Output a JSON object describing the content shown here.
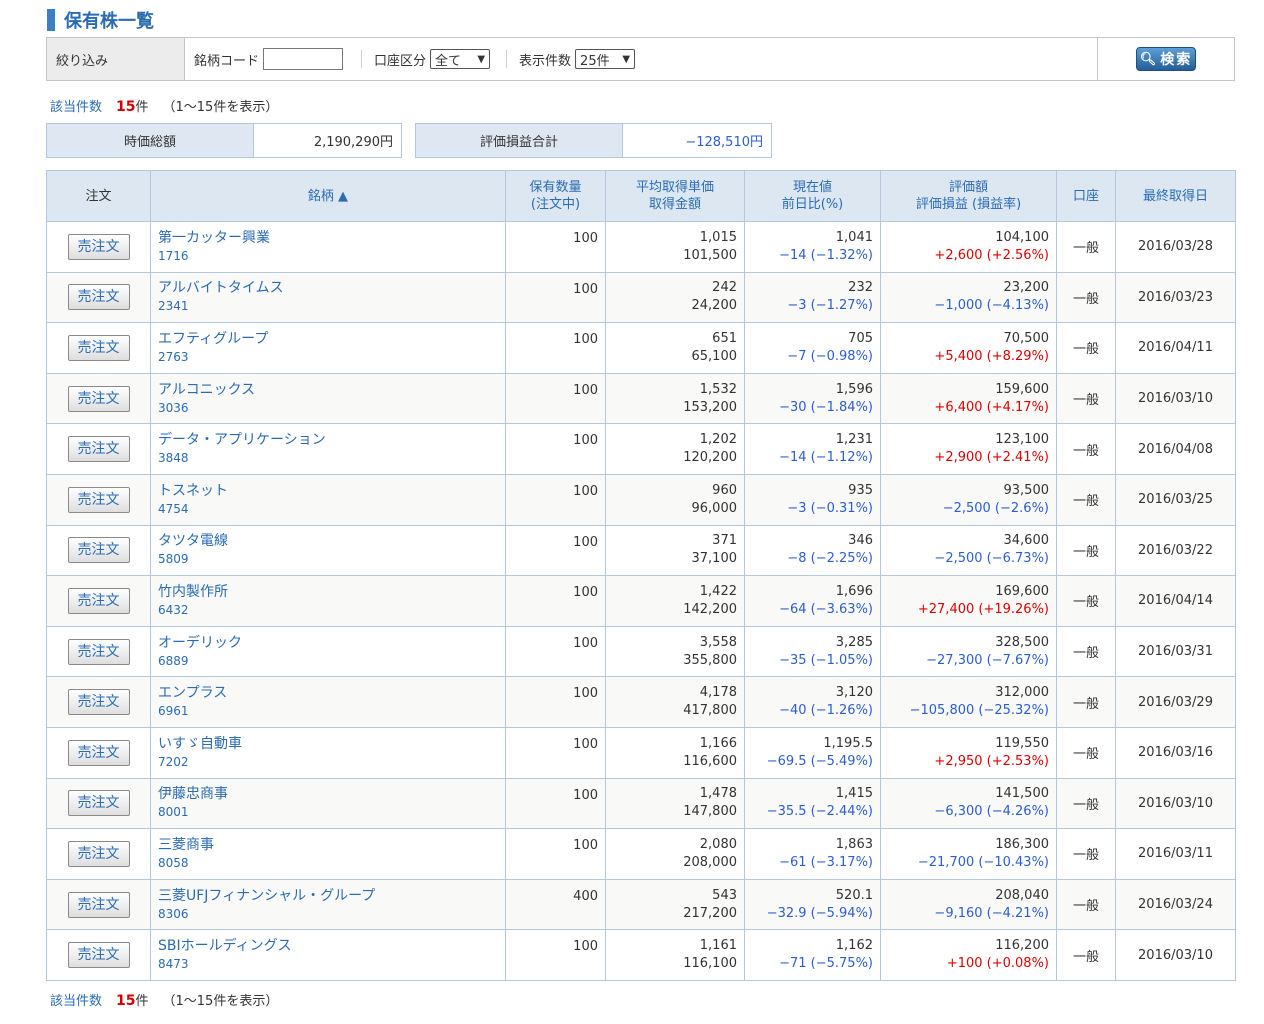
{
  "page": {
    "title": "保有株一覧"
  },
  "filter": {
    "label": "絞り込み",
    "code_label": "銘柄コード",
    "code_value": "",
    "account_label": "口座区分",
    "account_value": "全て",
    "count_label": "表示件数",
    "count_value": "25件",
    "search_label": "検索"
  },
  "summary": {
    "hits_label": "該当件数",
    "hits_count": "15",
    "hits_unit": "件",
    "hits_range": "（1～15件を表示）",
    "market_value_label": "時価総額",
    "market_value": "2,190,290円",
    "pl_label": "評価損益合計",
    "pl_value": "−128,510円"
  },
  "table": {
    "headers": {
      "order": "注文",
      "name": "銘柄 ▲",
      "qty": "保有数量",
      "qty_sub": "(注文中)",
      "avg": "平均取得単価",
      "avg_sub": "取得金額",
      "price": "現在値",
      "price_sub": "前日比(%)",
      "valuation": "評価額",
      "valuation_sub": "評価損益 (損益率)",
      "account": "口座",
      "date": "最終取得日"
    },
    "sell_label": "売注文",
    "rows": [
      {
        "name": "第一カッター興業",
        "code": "1716",
        "qty": "100",
        "avg": "1,015",
        "cost": "101,500",
        "price": "1,041",
        "change": "−14 (−1.32%)",
        "change_sign": "neg",
        "value": "104,100",
        "pl": "+2,600 (+2.56%)",
        "pl_sign": "pos",
        "account": "一般",
        "date": "2016/03/28"
      },
      {
        "name": "アルバイトタイムス",
        "code": "2341",
        "qty": "100",
        "avg": "242",
        "cost": "24,200",
        "price": "232",
        "change": "−3 (−1.27%)",
        "change_sign": "neg",
        "value": "23,200",
        "pl": "−1,000 (−4.13%)",
        "pl_sign": "neg",
        "account": "一般",
        "date": "2016/03/23"
      },
      {
        "name": "エフティグループ",
        "code": "2763",
        "qty": "100",
        "avg": "651",
        "cost": "65,100",
        "price": "705",
        "change": "−7 (−0.98%)",
        "change_sign": "neg",
        "value": "70,500",
        "pl": "+5,400 (+8.29%)",
        "pl_sign": "pos",
        "account": "一般",
        "date": "2016/04/11"
      },
      {
        "name": "アルコニックス",
        "code": "3036",
        "qty": "100",
        "avg": "1,532",
        "cost": "153,200",
        "price": "1,596",
        "change": "−30 (−1.84%)",
        "change_sign": "neg",
        "value": "159,600",
        "pl": "+6,400 (+4.17%)",
        "pl_sign": "pos",
        "account": "一般",
        "date": "2016/03/10"
      },
      {
        "name": "データ・アプリケーション",
        "code": "3848",
        "qty": "100",
        "avg": "1,202",
        "cost": "120,200",
        "price": "1,231",
        "change": "−14 (−1.12%)",
        "change_sign": "neg",
        "value": "123,100",
        "pl": "+2,900 (+2.41%)",
        "pl_sign": "pos",
        "account": "一般",
        "date": "2016/04/08"
      },
      {
        "name": "トスネット",
        "code": "4754",
        "qty": "100",
        "avg": "960",
        "cost": "96,000",
        "price": "935",
        "change": "−3 (−0.31%)",
        "change_sign": "neg",
        "value": "93,500",
        "pl": "−2,500 (−2.6%)",
        "pl_sign": "neg",
        "account": "一般",
        "date": "2016/03/25"
      },
      {
        "name": "タツタ電線",
        "code": "5809",
        "qty": "100",
        "avg": "371",
        "cost": "37,100",
        "price": "346",
        "change": "−8 (−2.25%)",
        "change_sign": "neg",
        "value": "34,600",
        "pl": "−2,500 (−6.73%)",
        "pl_sign": "neg",
        "account": "一般",
        "date": "2016/03/22"
      },
      {
        "name": "竹内製作所",
        "code": "6432",
        "qty": "100",
        "avg": "1,422",
        "cost": "142,200",
        "price": "1,696",
        "change": "−64 (−3.63%)",
        "change_sign": "neg",
        "value": "169,600",
        "pl": "+27,400 (+19.26%)",
        "pl_sign": "pos",
        "account": "一般",
        "date": "2016/04/14"
      },
      {
        "name": "オーデリック",
        "code": "6889",
        "qty": "100",
        "avg": "3,558",
        "cost": "355,800",
        "price": "3,285",
        "change": "−35 (−1.05%)",
        "change_sign": "neg",
        "value": "328,500",
        "pl": "−27,300 (−7.67%)",
        "pl_sign": "neg",
        "account": "一般",
        "date": "2016/03/31"
      },
      {
        "name": "エンプラス",
        "code": "6961",
        "qty": "100",
        "avg": "4,178",
        "cost": "417,800",
        "price": "3,120",
        "change": "−40 (−1.26%)",
        "change_sign": "neg",
        "value": "312,000",
        "pl": "−105,800 (−25.32%)",
        "pl_sign": "neg",
        "account": "一般",
        "date": "2016/03/29"
      },
      {
        "name": "いすゞ自動車",
        "code": "7202",
        "qty": "100",
        "avg": "1,166",
        "cost": "116,600",
        "price": "1,195.5",
        "change": "−69.5 (−5.49%)",
        "change_sign": "neg",
        "value": "119,550",
        "pl": "+2,950 (+2.53%)",
        "pl_sign": "pos",
        "account": "一般",
        "date": "2016/03/16"
      },
      {
        "name": "伊藤忠商事",
        "code": "8001",
        "qty": "100",
        "avg": "1,478",
        "cost": "147,800",
        "price": "1,415",
        "change": "−35.5 (−2.44%)",
        "change_sign": "neg",
        "value": "141,500",
        "pl": "−6,300 (−4.26%)",
        "pl_sign": "neg",
        "account": "一般",
        "date": "2016/03/10"
      },
      {
        "name": "三菱商事",
        "code": "8058",
        "qty": "100",
        "avg": "2,080",
        "cost": "208,000",
        "price": "1,863",
        "change": "−61 (−3.17%)",
        "change_sign": "neg",
        "value": "186,300",
        "pl": "−21,700 (−10.43%)",
        "pl_sign": "neg",
        "account": "一般",
        "date": "2016/03/11"
      },
      {
        "name": "三菱UFJフィナンシャル・グループ",
        "code": "8306",
        "qty": "400",
        "avg": "543",
        "cost": "217,200",
        "price": "520.1",
        "change": "−32.9 (−5.94%)",
        "change_sign": "neg",
        "value": "208,040",
        "pl": "−9,160 (−4.21%)",
        "pl_sign": "neg",
        "account": "一般",
        "date": "2016/03/24"
      },
      {
        "name": "SBIホールディングス",
        "code": "8473",
        "qty": "100",
        "avg": "1,161",
        "cost": "116,100",
        "price": "1,162",
        "change": "−71 (−5.75%)",
        "change_sign": "neg",
        "value": "116,200",
        "pl": "+100 (+0.08%)",
        "pl_sign": "pos",
        "account": "一般",
        "date": "2016/03/10"
      }
    ]
  },
  "colors": {
    "accent": "#2a6cb4",
    "gain": "#e00000",
    "loss": "#2b5dd8",
    "header_bg": "#dce7f2"
  }
}
